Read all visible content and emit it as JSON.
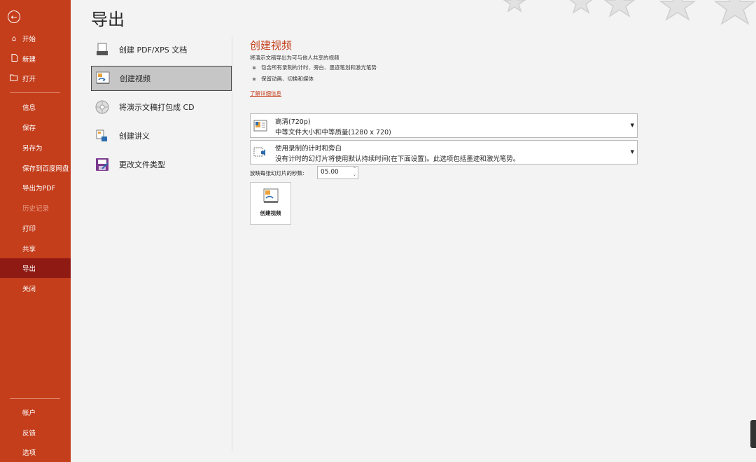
{
  "sidebar": {
    "top_items": [
      {
        "label": "开始",
        "icon": "home-icon"
      },
      {
        "label": "新建",
        "icon": "new-document-icon"
      },
      {
        "label": "打开",
        "icon": "open-folder-icon"
      }
    ],
    "mid_items": [
      {
        "label": "信息",
        "disabled": false
      },
      {
        "label": "保存",
        "disabled": false
      },
      {
        "label": "另存为",
        "disabled": false
      },
      {
        "label": "保存到百度网盘",
        "disabled": false
      },
      {
        "label": "导出为PDF",
        "disabled": false
      },
      {
        "label": "历史记录",
        "disabled": true
      },
      {
        "label": "打印",
        "disabled": false
      },
      {
        "label": "共享",
        "disabled": false
      },
      {
        "label": "导出",
        "active": true
      },
      {
        "label": "关闭",
        "disabled": false
      }
    ],
    "bottom_items": [
      {
        "label": "帐户"
      },
      {
        "label": "反馈"
      },
      {
        "label": "选项"
      }
    ],
    "colors": {
      "background": "#c43e1c",
      "active": "#8f1a14"
    }
  },
  "page": {
    "title": "导出"
  },
  "export_options": [
    {
      "label": "创建 PDF/XPS 文档",
      "icon": "pdf-document-icon"
    },
    {
      "label": "创建视频",
      "icon": "video-icon",
      "selected": true
    },
    {
      "label": "将演示文稿打包成 CD",
      "icon": "cd-icon"
    },
    {
      "label": "创建讲义",
      "icon": "handout-icon"
    },
    {
      "label": "更改文件类型",
      "icon": "save-as-icon"
    }
  ],
  "detail": {
    "title": "创建视频",
    "description": "将演示文稿导出为可与他人共享的视频",
    "bullets": [
      "包含所有录制的计时、旁白、墨迹笔划和激光笔势",
      "保留动画、切换和媒体"
    ],
    "learn_more": "了解详细信息",
    "quality": {
      "title": "高清(720p)",
      "subtitle": "中等文件大小和中等质量(1280 x 720)"
    },
    "timing": {
      "title": "使用录制的计时和旁白",
      "subtitle": "没有计时的幻灯片将使用默认持续时间(在下面设置)。此选项包括墨迹和激光笔势。"
    },
    "seconds_label": "放映每张幻灯片的秒数:",
    "seconds_value": "05.00",
    "create_button": "创建视频"
  }
}
